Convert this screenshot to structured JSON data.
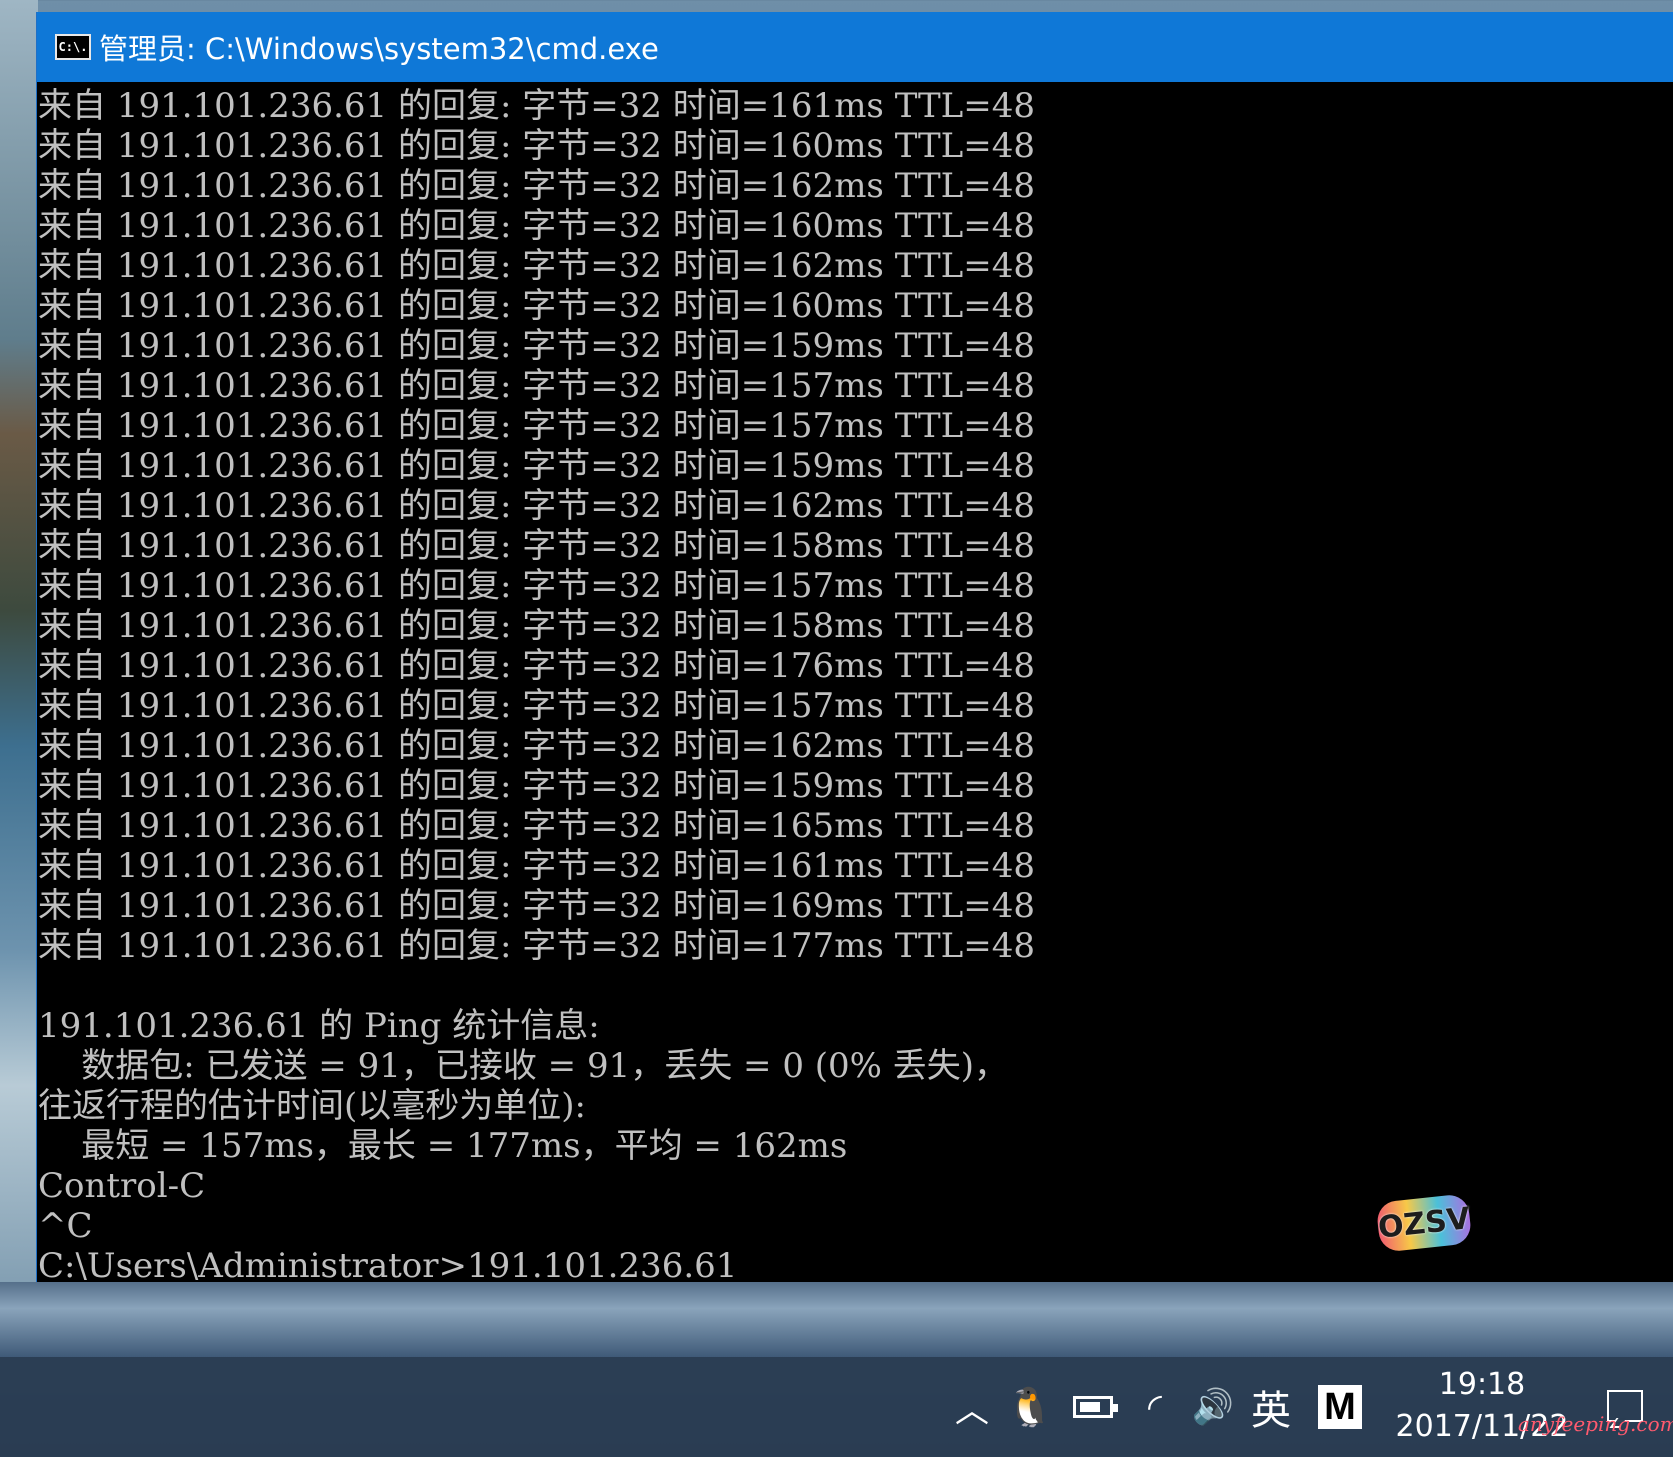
{
  "window": {
    "title": "管理员: C:\\Windows\\system32\\cmd.exe",
    "icon": "cmd-icon",
    "icon_text": "C:\\."
  },
  "console": {
    "lines": [
      "来自 191.101.236.61 的回复: 字节=32 时间=161ms TTL=48",
      "来自 191.101.236.61 的回复: 字节=32 时间=160ms TTL=48",
      "来自 191.101.236.61 的回复: 字节=32 时间=162ms TTL=48",
      "来自 191.101.236.61 的回复: 字节=32 时间=160ms TTL=48",
      "来自 191.101.236.61 的回复: 字节=32 时间=162ms TTL=48",
      "来自 191.101.236.61 的回复: 字节=32 时间=160ms TTL=48",
      "来自 191.101.236.61 的回复: 字节=32 时间=159ms TTL=48",
      "来自 191.101.236.61 的回复: 字节=32 时间=157ms TTL=48",
      "来自 191.101.236.61 的回复: 字节=32 时间=157ms TTL=48",
      "来自 191.101.236.61 的回复: 字节=32 时间=159ms TTL=48",
      "来自 191.101.236.61 的回复: 字节=32 时间=162ms TTL=48",
      "来自 191.101.236.61 的回复: 字节=32 时间=158ms TTL=48",
      "来自 191.101.236.61 的回复: 字节=32 时间=157ms TTL=48",
      "来自 191.101.236.61 的回复: 字节=32 时间=158ms TTL=48",
      "来自 191.101.236.61 的回复: 字节=32 时间=176ms TTL=48",
      "来自 191.101.236.61 的回复: 字节=32 时间=157ms TTL=48",
      "来自 191.101.236.61 的回复: 字节=32 时间=162ms TTL=48",
      "来自 191.101.236.61 的回复: 字节=32 时间=159ms TTL=48",
      "来自 191.101.236.61 的回复: 字节=32 时间=165ms TTL=48",
      "来自 191.101.236.61 的回复: 字节=32 时间=161ms TTL=48",
      "来自 191.101.236.61 的回复: 字节=32 时间=169ms TTL=48",
      "来自 191.101.236.61 的回复: 字节=32 时间=177ms TTL=48",
      "",
      "191.101.236.61 的 Ping 统计信息:",
      "    数据包: 已发送 = 91，已接收 = 91，丢失 = 0 (0% 丢失)，",
      "往返行程的估计时间(以毫秒为单位):",
      "    最短 = 157ms，最长 = 177ms，平均 = 162ms",
      "Control-C",
      "^C",
      "C:\\Users\\Administrator>191.101.236.61"
    ]
  },
  "sticker": {
    "text": "OZSV"
  },
  "taskbar": {
    "tray": [
      {
        "name": "show-hidden-icons-chevron-icon",
        "glyph": "︿"
      },
      {
        "name": "qq-penguin-icon",
        "glyph": "🐧"
      },
      {
        "name": "power-battery-icon",
        "glyph": ""
      },
      {
        "name": "wifi-icon",
        "glyph": "◜"
      },
      {
        "name": "volume-icon",
        "glyph": "🔊"
      }
    ],
    "ime_label": "英",
    "m_label": "M",
    "time": "19:18",
    "date": "2017/11/22",
    "notification_icon": "action-center-icon"
  },
  "watermark": {
    "text": "anyfeeping.com"
  },
  "colors": {
    "titlebar": "#0f78d7",
    "console_bg": "#000000",
    "console_text": "#c0c0c0",
    "taskbar": "#2a3c52"
  }
}
